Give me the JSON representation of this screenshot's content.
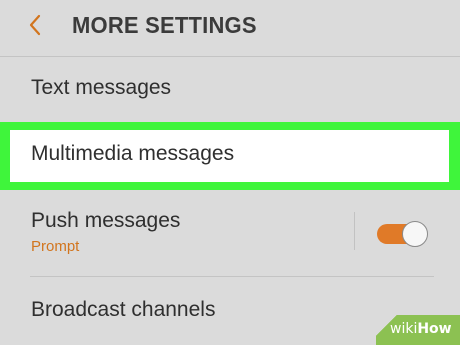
{
  "header": {
    "back_icon": "chevron-left-icon",
    "title": "MORE SETTINGS",
    "accent_color": "#d2751e"
  },
  "settings": {
    "items": [
      {
        "label": "Text messages"
      },
      {
        "label": "Multimedia messages",
        "highlighted": true
      },
      {
        "label": "Push messages",
        "subtitle": "Prompt",
        "toggle_on": true
      },
      {
        "label": "Broadcast channels"
      }
    ]
  },
  "colors": {
    "background": "#dbdbdb",
    "highlight": "#3ff53b",
    "toggle_on": "#e07a28"
  },
  "watermark": {
    "text_regular": "wiki",
    "text_bold": "How"
  }
}
